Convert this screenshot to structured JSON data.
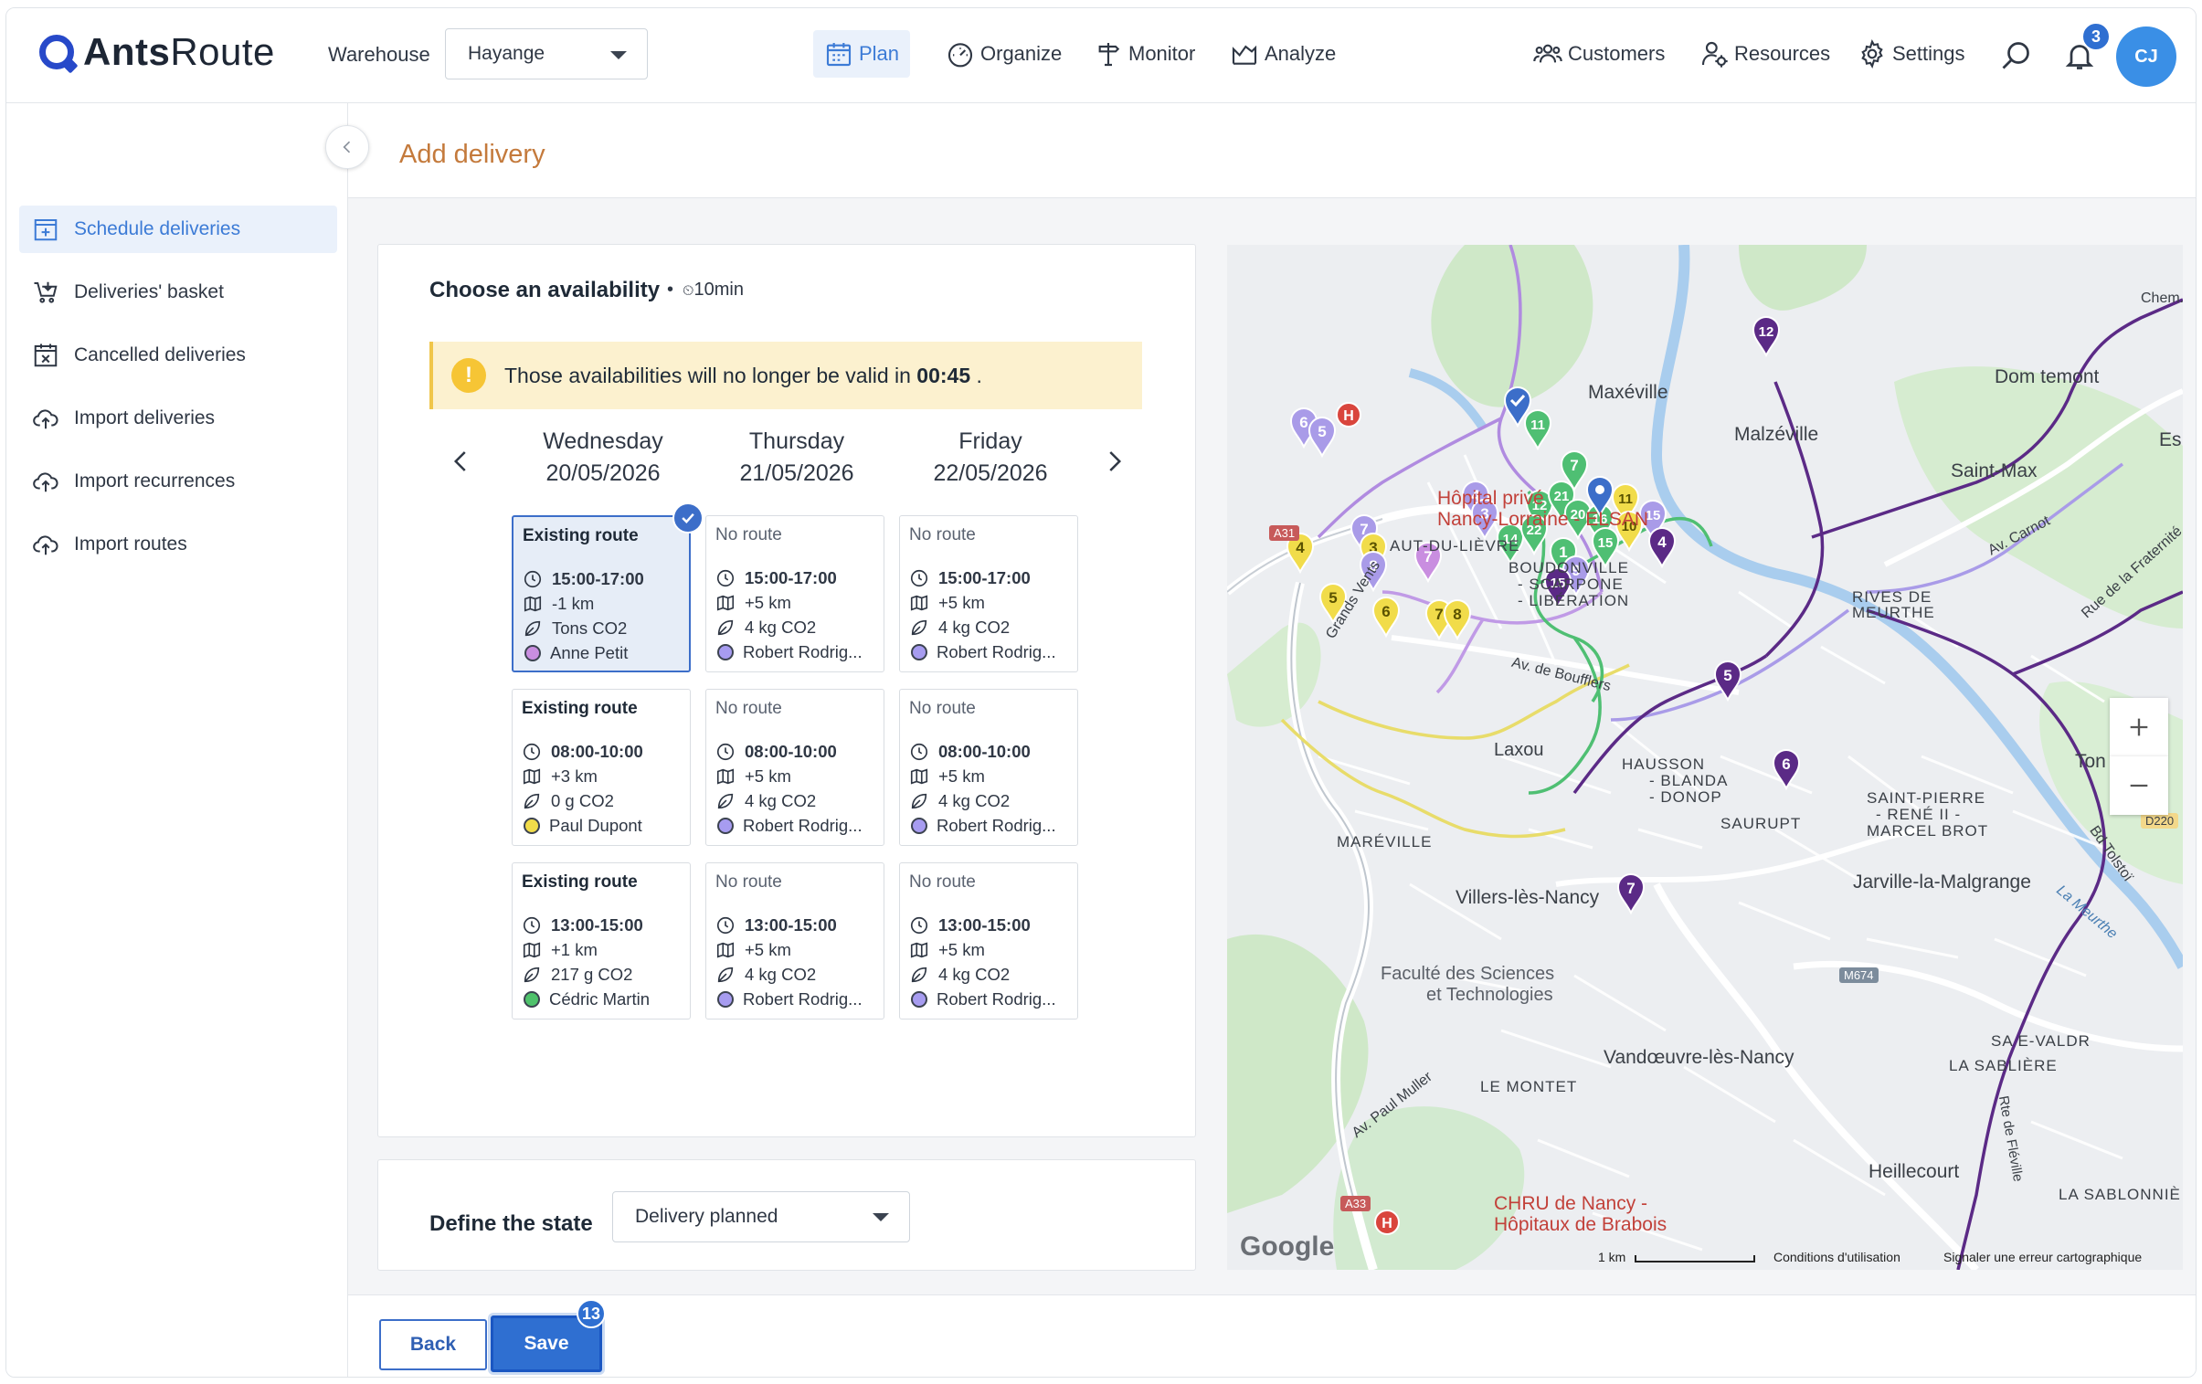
{
  "app": {
    "brand_bold": "Ants",
    "brand_light": "Route"
  },
  "header": {
    "warehouse_label": "Warehouse",
    "warehouse_value": "Hayange",
    "nav": {
      "plan": "Plan",
      "organize": "Organize",
      "monitor": "Monitor",
      "analyze": "Analyze"
    },
    "right": {
      "customers": "Customers",
      "resources": "Resources",
      "settings": "Settings"
    },
    "notification_count": "3",
    "avatar_initials": "CJ"
  },
  "sidebar": {
    "items": [
      {
        "label": "Schedule deliveries",
        "icon": "calendar-plus-icon",
        "active": true
      },
      {
        "label": "Deliveries' basket",
        "icon": "basket-icon"
      },
      {
        "label": "Cancelled deliveries",
        "icon": "calendar-x-icon"
      },
      {
        "label": "Import deliveries",
        "icon": "cloud-upload-icon"
      },
      {
        "label": "Import recurrences",
        "icon": "cloud-upload-icon"
      },
      {
        "label": "Import routes",
        "icon": "cloud-upload-icon"
      }
    ]
  },
  "page": {
    "title": "Add delivery"
  },
  "availability": {
    "title": "Choose an availability",
    "duration": "10min",
    "warning_text": "Those availabilities will no longer be valid in",
    "warning_time": "00:45",
    "warning_end": ".",
    "days": [
      {
        "weekday": "Wednesday",
        "date": "20/05/2026"
      },
      {
        "weekday": "Thursday",
        "date": "21/05/2026"
      },
      {
        "weekday": "Friday",
        "date": "22/05/2026"
      }
    ],
    "slots": [
      [
        {
          "heading": "Existing route",
          "time": "15:00-17:00",
          "distance": "-1 km",
          "co2": "Tons CO2",
          "driver": "Anne Petit",
          "color": "#c98ee0",
          "selected": true
        },
        {
          "heading": "Existing route",
          "time": "08:00-10:00",
          "distance": "+3 km",
          "co2": "0 g CO2",
          "driver": "Paul Dupont",
          "color": "#f1dc4a"
        },
        {
          "heading": "Existing route",
          "time": "13:00-15:00",
          "distance": "+1 km",
          "co2": "217 g CO2",
          "driver": "Cédric Martin",
          "color": "#4fc26b"
        }
      ],
      [
        {
          "heading": "No route",
          "time": "15:00-17:00",
          "distance": "+5 km",
          "co2": "4 kg CO2",
          "driver": "Robert Rodrig...",
          "color": "#a79cf0"
        },
        {
          "heading": "No route",
          "time": "08:00-10:00",
          "distance": "+5 km",
          "co2": "4 kg CO2",
          "driver": "Robert Rodrig...",
          "color": "#a79cf0"
        },
        {
          "heading": "No route",
          "time": "13:00-15:00",
          "distance": "+5 km",
          "co2": "4 kg CO2",
          "driver": "Robert Rodrig...",
          "color": "#a79cf0"
        }
      ],
      [
        {
          "heading": "No route",
          "time": "15:00-17:00",
          "distance": "+5 km",
          "co2": "4 kg CO2",
          "driver": "Robert Rodrig...",
          "color": "#a79cf0"
        },
        {
          "heading": "No route",
          "time": "08:00-10:00",
          "distance": "+5 km",
          "co2": "4 kg CO2",
          "driver": "Robert Rodrig...",
          "color": "#a79cf0"
        },
        {
          "heading": "No route",
          "time": "13:00-15:00",
          "distance": "+5 km",
          "co2": "4 kg CO2",
          "driver": "Robert Rodrig...",
          "color": "#a79cf0"
        }
      ]
    ]
  },
  "state": {
    "label": "Define the state",
    "value": "Delivery planned"
  },
  "footer": {
    "back": "Back",
    "save": "Save",
    "save_badge": "13"
  },
  "map": {
    "labels": {
      "maxeville": "Maxéville",
      "malzeville": "Malzéville",
      "saint_max": "Saint-Max",
      "dommartemont": "Dom   temont",
      "es": "Es",
      "chem": "Chem.",
      "hopital": "Hôpital privé",
      "hopital2": "Nancy-Lorraine - ELSAN",
      "lievre": "AUT-DU-LIÈVRE",
      "boudonville": "BOUDONVILLE",
      "scarpone": "- SCARPONE",
      "liberation": "- LIBÉRATION",
      "rives": "RIVES DE",
      "meurthe": "MEURTHE",
      "laxou": "Laxou",
      "haussonville": "HAUSSON",
      "blandan": "- BLANDA",
      "donop": "- DONOP",
      "saurupt": "SAURUPT",
      "saint_pierre": "SAINT-PIERRE",
      "rene": "- RENÉ II -",
      "marcel": "MARCEL  BROT",
      "mareville": "MARÉVILLE",
      "villers": "Villers-lès-Nancy",
      "jarville": "Jarville-la-Malgrange",
      "faculte": "Faculté des Sciences",
      "faculte2": "et Technologies",
      "vandoeuvre": "Vandœuvre-lès-Nancy",
      "le_montet": "LE MONTET",
      "sablière": "LA SABLIÈRE",
      "sa_valdr": "SA    E-VALDR",
      "heillecourt": "Heillecourt",
      "sablonniere": "LA SABLONNIÈ",
      "chru": "CHRU de Nancy -",
      "chru2": "Hôpitaux de Brabois",
      "tom": "Ton",
      "av_carnot": "Av. Carnot",
      "fraternite": "Rue de la Fraternité",
      "av_boufflers": "Av. de Boufflers",
      "av_muller": "Av. Paul Muller",
      "grands_vents": "Grands Vents",
      "tolstoi": "Bd Tolstoï",
      "la_meurthe": "La Meurthe",
      "feville": "Rte de Fléville",
      "a31": "A31",
      "a33": "A33",
      "m674": "M674",
      "d220": "D220",
      "google": "Google",
      "scale": "1 km",
      "terms": "Conditions d'utilisation",
      "report": "Signaler une erreur cartographique"
    },
    "markers": [
      {
        "n": "12",
        "color": "#5b2a86"
      },
      {
        "n": "6",
        "color": "#a99be8"
      },
      {
        "n": "5",
        "color": "#a99be8"
      },
      {
        "n": "11",
        "color": "#4fbf73"
      },
      {
        "n": "7",
        "color": "#4fbf73"
      },
      {
        "n": "4",
        "color": "#a99be8"
      },
      {
        "n": "3",
        "color": "#a99be8"
      },
      {
        "n": "12",
        "color": "#4fbf73"
      },
      {
        "n": "21",
        "color": "#4fbf73"
      },
      {
        "n": "20",
        "color": "#4fbf73"
      },
      {
        "n": "14",
        "color": "#4fbf73"
      },
      {
        "n": "22",
        "color": "#4fbf73"
      },
      {
        "n": "16",
        "color": "#4fbf73"
      },
      {
        "n": "15",
        "color": "#4fbf73"
      },
      {
        "n": "11",
        "color": "#f1dc4a"
      },
      {
        "n": "10",
        "color": "#f1dc4a"
      },
      {
        "n": "15",
        "color": "#a99be8"
      },
      {
        "n": "4",
        "color": "#5b2a86"
      },
      {
        "n": "1",
        "color": "#4fbf73"
      },
      {
        "n": "9",
        "color": "#a99be8"
      },
      {
        "n": "15",
        "color": "#5b2a86"
      },
      {
        "n": "7",
        "color": "#c98ee0"
      },
      {
        "n": "4",
        "color": "#f1dc4a"
      },
      {
        "n": "7",
        "color": "#a99be8"
      },
      {
        "n": "3",
        "color": "#f1dc4a"
      },
      {
        "n": "8",
        "color": "#a99be8"
      },
      {
        "n": "5",
        "color": "#f1dc4a"
      },
      {
        "n": "6",
        "color": "#f1dc4a"
      },
      {
        "n": "7",
        "color": "#f1dc4a"
      },
      {
        "n": "8",
        "color": "#f1dc4a"
      },
      {
        "n": "5",
        "color": "#5b2a86"
      },
      {
        "n": "6",
        "color": "#5b2a86"
      },
      {
        "n": "7",
        "color": "#5b2a86"
      }
    ]
  }
}
